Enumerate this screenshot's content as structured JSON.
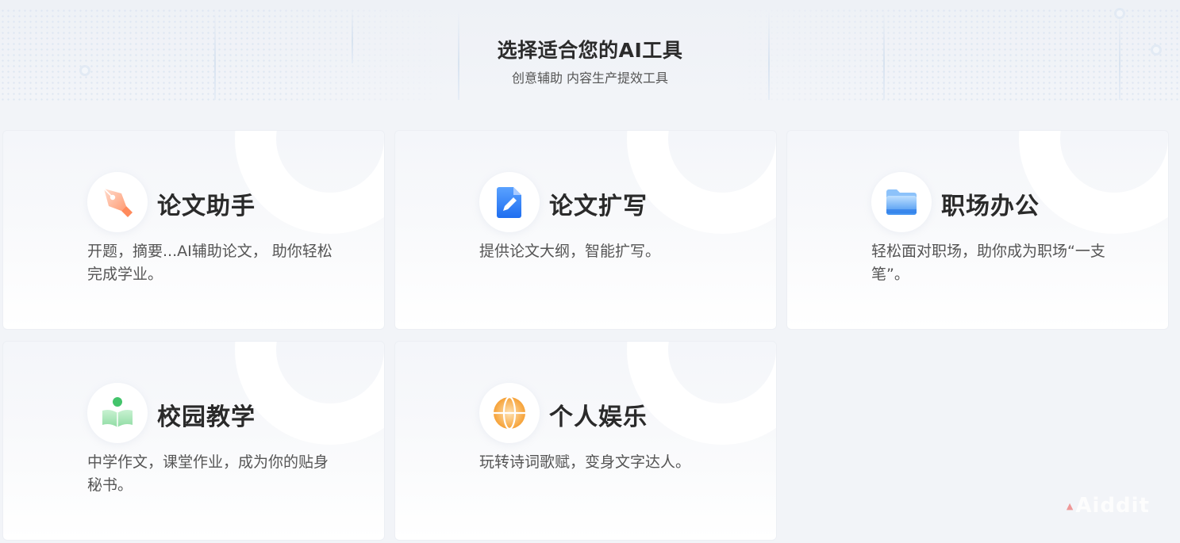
{
  "header": {
    "title": "选择适合您的AI工具",
    "subtitle": "创意辅助 内容生产提效工具"
  },
  "cards": [
    {
      "title": "论文助手",
      "desc": "开题，摘要...AI辅助论文， 助你轻松完成学业。",
      "icon": "pen-nib-icon"
    },
    {
      "title": "论文扩写",
      "desc": "提供论文大纲，智能扩写。",
      "icon": "document-edit-icon"
    },
    {
      "title": "职场办公",
      "desc": "轻松面对职场，助你成为职场“一支笔”。",
      "icon": "folder-icon"
    },
    {
      "title": "校园教学",
      "desc": "中学作文，课堂作业，成为你的贴身秘书。",
      "icon": "reading-student-icon"
    },
    {
      "title": "个人娱乐",
      "desc": "玩转诗词歌赋，变身文字达人。",
      "icon": "globe-icon"
    }
  ],
  "watermark": {
    "text": "Aiddit"
  },
  "colors": {
    "page_bg": "#f2f4f8",
    "pen_orange": "#ff8a5c",
    "doc_blue": "#2f7cf6",
    "folder_blue": "#5aa6f5",
    "student_green": "#43c46b",
    "globe_orange": "#f6a53a"
  }
}
